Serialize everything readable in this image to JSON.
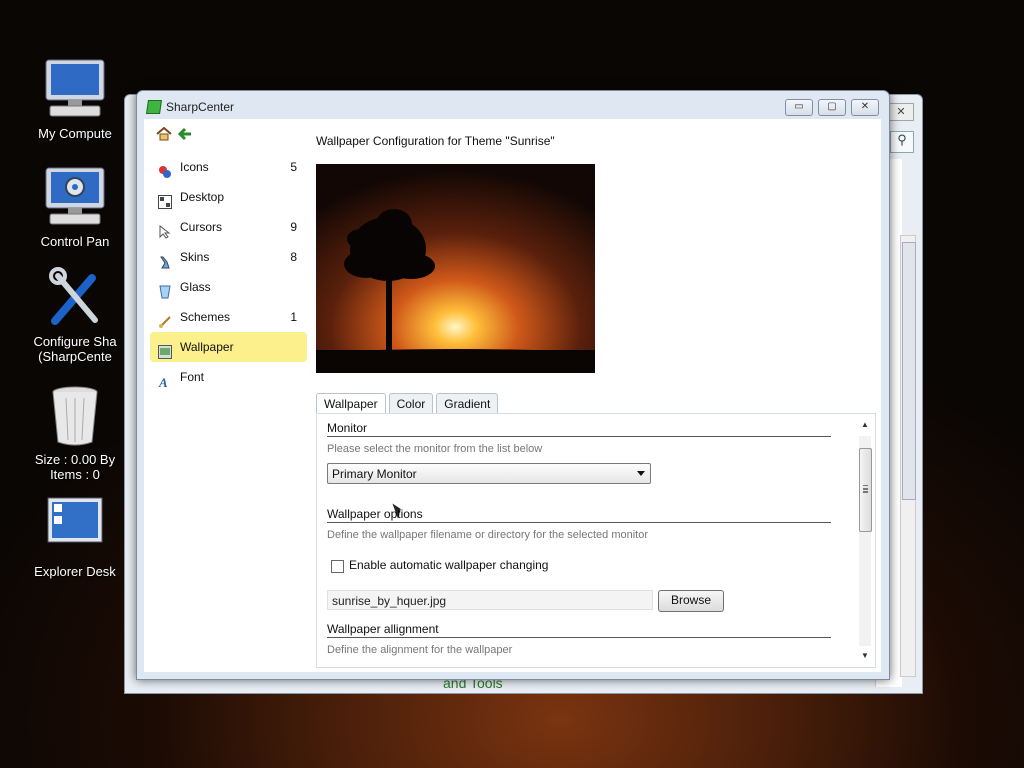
{
  "desktop": {
    "icons": [
      {
        "label": "My Compute",
        "icon": "computer-icon"
      },
      {
        "label": "Control Pan",
        "icon": "control-panel-icon"
      },
      {
        "label": "Configure Sha",
        "label2": "(SharpCente",
        "icon": "tools-icon"
      },
      {
        "label": "Size : 0.00 By",
        "label2": "Items : 0",
        "icon": "recycle-bin-icon"
      },
      {
        "label": "Explorer Desk",
        "icon": "explorer-desktop-icon"
      }
    ]
  },
  "bg_window": {
    "close": "✕",
    "search_icon": "search-icon",
    "bottom_text": "and Tools"
  },
  "window": {
    "title": "SharpCenter",
    "controls": {
      "minimize": "▭",
      "maximize": "▢",
      "close": "✕"
    }
  },
  "sidebar": {
    "home_icon": "home-icon",
    "back_icon": "back-arrow-icon",
    "items": [
      {
        "label": "Icons",
        "count": "5",
        "icon": "icons-icon"
      },
      {
        "label": "Desktop",
        "count": "",
        "icon": "desktop-icon"
      },
      {
        "label": "Cursors",
        "count": "9",
        "icon": "cursor-icon"
      },
      {
        "label": "Skins",
        "count": "8",
        "icon": "skins-icon"
      },
      {
        "label": "Glass",
        "count": "",
        "icon": "glass-icon"
      },
      {
        "label": "Schemes",
        "count": "1",
        "icon": "brush-icon"
      },
      {
        "label": "Wallpaper",
        "count": "",
        "icon": "wallpaper-icon",
        "selected": true
      },
      {
        "label": "Font",
        "count": "",
        "icon": "font-icon"
      }
    ]
  },
  "main": {
    "heading": "Wallpaper Configuration for Theme \"Sunrise\"",
    "tabs": [
      "Wallpaper",
      "Color",
      "Gradient"
    ],
    "active_tab": "Wallpaper",
    "monitor": {
      "title": "Monitor",
      "desc": "Please select the monitor from the list below",
      "selected": "Primary Monitor"
    },
    "options": {
      "title": "Wallpaper options",
      "desc": "Define the wallpaper filename or directory for the selected monitor",
      "checkbox_label": "Enable automatic wallpaper changing",
      "checkbox_checked": false,
      "filename": "sunrise_by_hquer.jpg",
      "browse_label": "Browse"
    },
    "alignment": {
      "title": "Wallpaper allignment",
      "desc": "Define the alignment for the wallpaper"
    }
  }
}
